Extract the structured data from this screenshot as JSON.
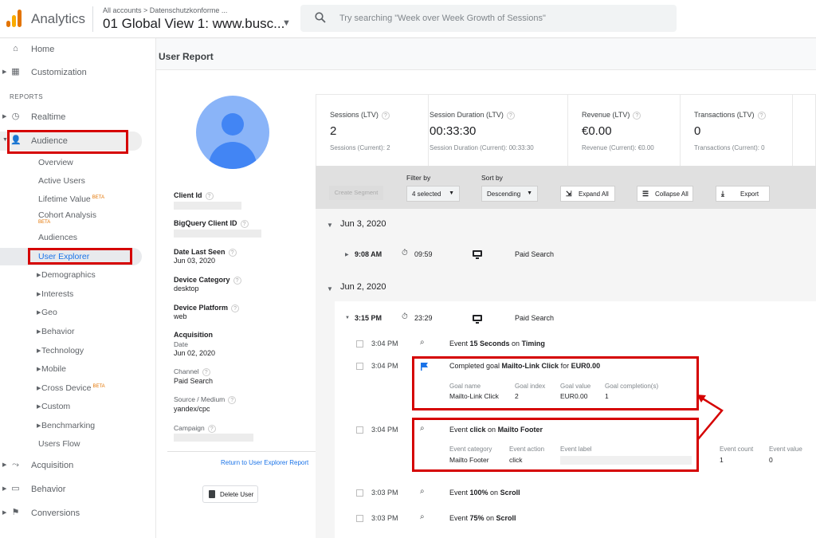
{
  "header": {
    "app_name": "Analytics",
    "account_path": "All accounts > Datenschutzkonforme ...",
    "view_name": "01 Global View 1: www.busc...",
    "search_placeholder": "Try searching \"Week over Week Growth of Sessions\""
  },
  "sidebar": {
    "home": "Home",
    "customization": "Customization",
    "reports_section": "REPORTS",
    "realtime": "Realtime",
    "audience": "Audience",
    "audience_items": {
      "overview": "Overview",
      "active_users": "Active Users",
      "lifetime_value": "Lifetime Value",
      "lifetime_value_badge": "BETA",
      "cohort_analysis": "Cohort Analysis",
      "cohort_analysis_badge": "BETA",
      "audiences": "Audiences",
      "user_explorer": "User Explorer",
      "demographics": "Demographics",
      "interests": "Interests",
      "geo": "Geo",
      "behavior": "Behavior",
      "technology": "Technology",
      "mobile": "Mobile",
      "cross_device": "Cross Device",
      "cross_device_badge": "BETA",
      "custom": "Custom",
      "benchmarking": "Benchmarking",
      "users_flow": "Users Flow"
    },
    "acquisition": "Acquisition",
    "behavior": "Behavior",
    "conversions": "Conversions"
  },
  "page": {
    "title": "User Report"
  },
  "user_info": {
    "client_id_label": "Client Id",
    "bigquery_label": "BigQuery Client ID",
    "date_last_seen_label": "Date Last Seen",
    "date_last_seen_value": "Jun 03, 2020",
    "device_category_label": "Device Category",
    "device_category_value": "desktop",
    "device_platform_label": "Device Platform",
    "device_platform_value": "web",
    "acquisition_label": "Acquisition",
    "acquisition_date_label": "Date",
    "acquisition_date_value": "Jun 02, 2020",
    "channel_label": "Channel",
    "channel_value": "Paid Search",
    "source_medium_label": "Source / Medium",
    "source_medium_value": "yandex/cpc",
    "campaign_label": "Campaign",
    "return_link": "Return to User Explorer Report",
    "delete_button": "Delete User"
  },
  "stats": [
    {
      "label": "Sessions (LTV)",
      "value": "2",
      "sub": "Sessions (Current): 2"
    },
    {
      "label": "Session Duration (LTV)",
      "value": "00:33:30",
      "sub": "Session Duration (Current): 00:33:30"
    },
    {
      "label": "Revenue (LTV)",
      "value": "€0.00",
      "sub": "Revenue (Current): €0.00"
    },
    {
      "label": "Transactions (LTV)",
      "value": "0",
      "sub": "Transactions (Current): 0"
    }
  ],
  "filters": {
    "create_segment": "Create Segment",
    "filter_by_label": "Filter by",
    "filter_by_value": "4 selected",
    "sort_by_label": "Sort by",
    "sort_by_value": "Descending",
    "expand_all": "Expand All",
    "collapse_all": "Collapse All",
    "export": "Export"
  },
  "timeline": {
    "day1": {
      "date": "Jun 3, 2020",
      "session_time": "9:08 AM",
      "duration": "09:59",
      "channel": "Paid Search"
    },
    "day2": {
      "date": "Jun 2, 2020",
      "session_time": "3:15 PM",
      "duration": "23:29",
      "channel": "Paid Search",
      "events": [
        {
          "time": "3:04 PM",
          "prefix": "Event ",
          "bold": "15 Seconds",
          "mid": " on ",
          "bold2": "Timing"
        },
        {
          "time": "3:04 PM",
          "prefix": "Completed goal ",
          "bold": "Mailto-Link Click",
          "mid": " for ",
          "bold2": "EUR0.00"
        },
        {
          "time": "3:04 PM",
          "prefix": "Event ",
          "bold": "click",
          "mid": " on ",
          "bold2": "Mailto Footer"
        },
        {
          "time": "3:03 PM",
          "prefix": "Event ",
          "bold": "100%",
          "mid": " on ",
          "bold2": "Scroll"
        },
        {
          "time": "3:03 PM",
          "prefix": "Event ",
          "bold": "75%",
          "mid": " on ",
          "bold2": "Scroll"
        }
      ],
      "goal_details": {
        "goal_name_label": "Goal name",
        "goal_name_value": "Mailto-Link Click",
        "goal_index_label": "Goal index",
        "goal_index_value": "2",
        "goal_value_label": "Goal value",
        "goal_value_value": "EUR0.00",
        "goal_completions_label": "Goal completion(s)",
        "goal_completions_value": "1"
      },
      "event_details": {
        "category_label": "Event category",
        "category_value": "Mailto Footer",
        "action_label": "Event action",
        "action_value": "click",
        "label_label": "Event label",
        "count_label": "Event count",
        "count_value": "1",
        "value_label": "Event value",
        "value_value": "0"
      }
    }
  },
  "colors": {
    "highlight": "#d50000",
    "link": "#1a73e8",
    "logo_orange": "#f9ab00",
    "logo_dark": "#e37400"
  }
}
